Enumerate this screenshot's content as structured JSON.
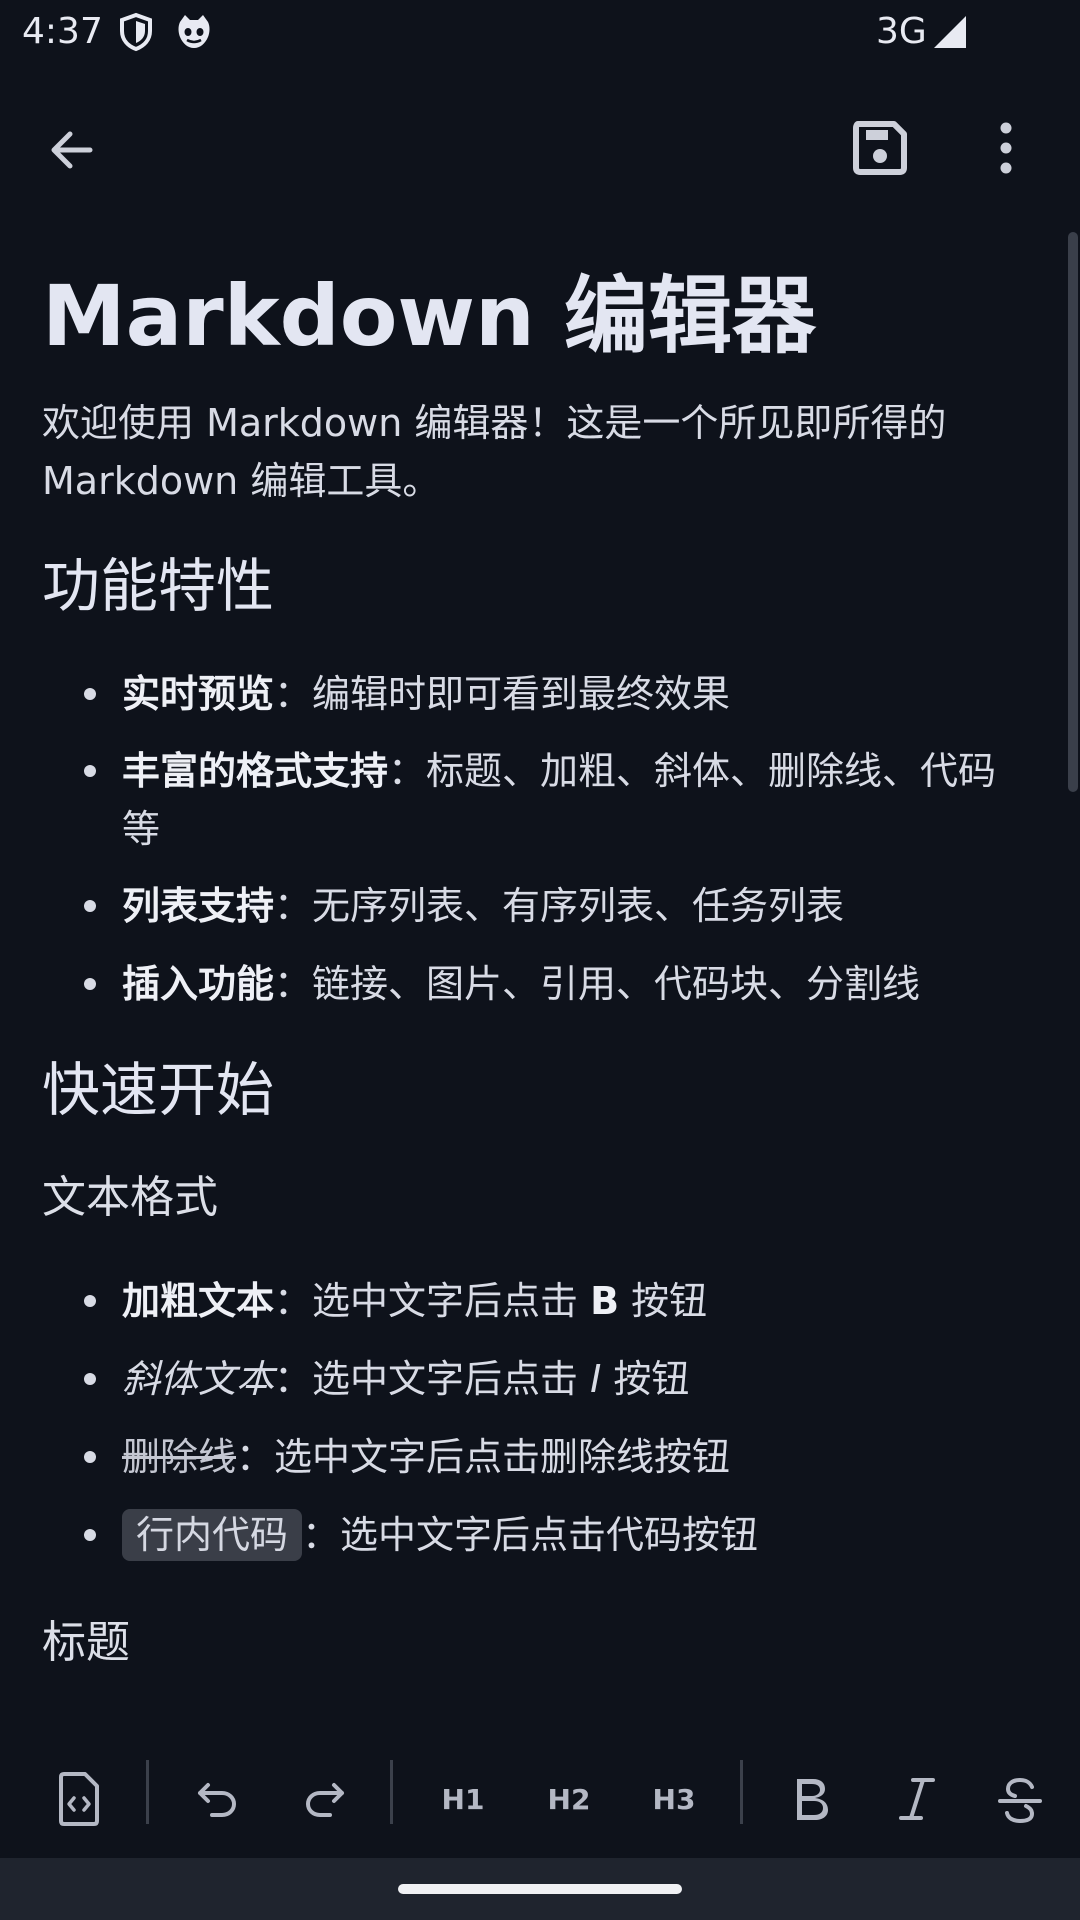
{
  "status_bar": {
    "time": "4:37",
    "network": "3G",
    "icons": [
      "shield-icon",
      "cat-face-icon",
      "signal-icon"
    ]
  },
  "app_bar": {
    "icons": [
      "arrow-back-icon",
      "save-icon",
      "more-vert-icon"
    ]
  },
  "document": {
    "title": "Markdown 编辑器",
    "intro": "欢迎使用 Markdown 编辑器！这是一个所见即所得的 Markdown 编辑工具。",
    "features_heading": "功能特性",
    "features": [
      {
        "label": "实时预览",
        "sep": "：",
        "text": "编辑时即可看到最终效果"
      },
      {
        "label": "丰富的格式支持",
        "sep": "：",
        "text": "标题、加粗、斜体、删除线、代码等"
      },
      {
        "label": "列表支持",
        "sep": "：",
        "text": "无序列表、有序列表、任务列表"
      },
      {
        "label": "插入功能",
        "sep": "：",
        "text": "链接、图片、引用、代码块、分割线"
      }
    ],
    "quickstart_heading": "快速开始",
    "text_format_heading": "文本格式",
    "text_formats": [
      {
        "label": "加粗文本",
        "sep": "：",
        "text": "选中文字后点击 ",
        "key": "B",
        "suffix": " 按钮"
      },
      {
        "label": "斜体文本",
        "sep": "：",
        "text": "选中文字后点击 ",
        "key": "I",
        "suffix": " 按钮"
      },
      {
        "label": "删除线",
        "sep": "：",
        "text": "选中文字后点击删除线按钮"
      },
      {
        "label": "行内代码",
        "sep": "：",
        "text": "选中文字后点击代码按钮"
      }
    ],
    "headings_heading": "标题"
  },
  "toolbar": {
    "h1": "H1",
    "h2": "H2",
    "h3": "H3",
    "icons": [
      "code-file-icon",
      "undo-icon",
      "redo-icon",
      "bold-icon",
      "italic-icon",
      "strikethrough-icon"
    ]
  },
  "colors": {
    "background": "#0e121b",
    "text": "#e4e6ef",
    "inline_code_bg": "#3a3e48",
    "toolbar_icon": "#b4b8c4",
    "nav_bar": "#1f242e"
  }
}
